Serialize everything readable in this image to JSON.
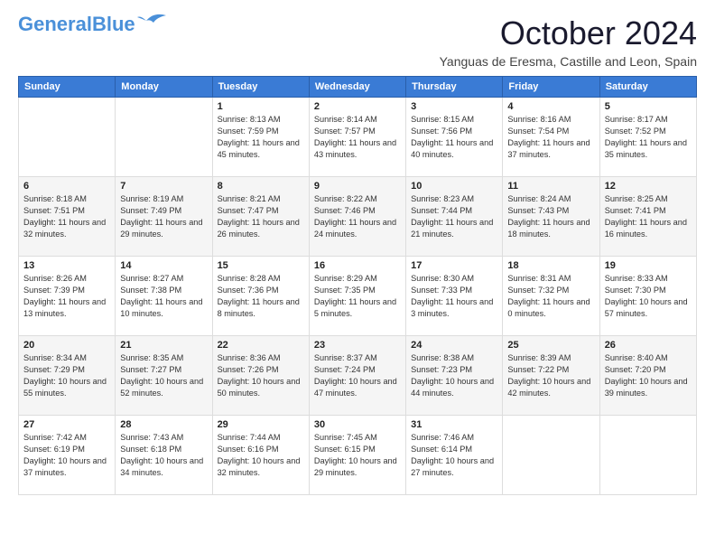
{
  "logo": {
    "line1": "General",
    "line2": "Blue"
  },
  "title": "October 2024",
  "location": "Yanguas de Eresma, Castille and Leon, Spain",
  "days_of_week": [
    "Sunday",
    "Monday",
    "Tuesday",
    "Wednesday",
    "Thursday",
    "Friday",
    "Saturday"
  ],
  "weeks": [
    [
      {
        "day": "",
        "info": ""
      },
      {
        "day": "",
        "info": ""
      },
      {
        "day": "1",
        "info": "Sunrise: 8:13 AM\nSunset: 7:59 PM\nDaylight: 11 hours and 45 minutes."
      },
      {
        "day": "2",
        "info": "Sunrise: 8:14 AM\nSunset: 7:57 PM\nDaylight: 11 hours and 43 minutes."
      },
      {
        "day": "3",
        "info": "Sunrise: 8:15 AM\nSunset: 7:56 PM\nDaylight: 11 hours and 40 minutes."
      },
      {
        "day": "4",
        "info": "Sunrise: 8:16 AM\nSunset: 7:54 PM\nDaylight: 11 hours and 37 minutes."
      },
      {
        "day": "5",
        "info": "Sunrise: 8:17 AM\nSunset: 7:52 PM\nDaylight: 11 hours and 35 minutes."
      }
    ],
    [
      {
        "day": "6",
        "info": "Sunrise: 8:18 AM\nSunset: 7:51 PM\nDaylight: 11 hours and 32 minutes."
      },
      {
        "day": "7",
        "info": "Sunrise: 8:19 AM\nSunset: 7:49 PM\nDaylight: 11 hours and 29 minutes."
      },
      {
        "day": "8",
        "info": "Sunrise: 8:21 AM\nSunset: 7:47 PM\nDaylight: 11 hours and 26 minutes."
      },
      {
        "day": "9",
        "info": "Sunrise: 8:22 AM\nSunset: 7:46 PM\nDaylight: 11 hours and 24 minutes."
      },
      {
        "day": "10",
        "info": "Sunrise: 8:23 AM\nSunset: 7:44 PM\nDaylight: 11 hours and 21 minutes."
      },
      {
        "day": "11",
        "info": "Sunrise: 8:24 AM\nSunset: 7:43 PM\nDaylight: 11 hours and 18 minutes."
      },
      {
        "day": "12",
        "info": "Sunrise: 8:25 AM\nSunset: 7:41 PM\nDaylight: 11 hours and 16 minutes."
      }
    ],
    [
      {
        "day": "13",
        "info": "Sunrise: 8:26 AM\nSunset: 7:39 PM\nDaylight: 11 hours and 13 minutes."
      },
      {
        "day": "14",
        "info": "Sunrise: 8:27 AM\nSunset: 7:38 PM\nDaylight: 11 hours and 10 minutes."
      },
      {
        "day": "15",
        "info": "Sunrise: 8:28 AM\nSunset: 7:36 PM\nDaylight: 11 hours and 8 minutes."
      },
      {
        "day": "16",
        "info": "Sunrise: 8:29 AM\nSunset: 7:35 PM\nDaylight: 11 hours and 5 minutes."
      },
      {
        "day": "17",
        "info": "Sunrise: 8:30 AM\nSunset: 7:33 PM\nDaylight: 11 hours and 3 minutes."
      },
      {
        "day": "18",
        "info": "Sunrise: 8:31 AM\nSunset: 7:32 PM\nDaylight: 11 hours and 0 minutes."
      },
      {
        "day": "19",
        "info": "Sunrise: 8:33 AM\nSunset: 7:30 PM\nDaylight: 10 hours and 57 minutes."
      }
    ],
    [
      {
        "day": "20",
        "info": "Sunrise: 8:34 AM\nSunset: 7:29 PM\nDaylight: 10 hours and 55 minutes."
      },
      {
        "day": "21",
        "info": "Sunrise: 8:35 AM\nSunset: 7:27 PM\nDaylight: 10 hours and 52 minutes."
      },
      {
        "day": "22",
        "info": "Sunrise: 8:36 AM\nSunset: 7:26 PM\nDaylight: 10 hours and 50 minutes."
      },
      {
        "day": "23",
        "info": "Sunrise: 8:37 AM\nSunset: 7:24 PM\nDaylight: 10 hours and 47 minutes."
      },
      {
        "day": "24",
        "info": "Sunrise: 8:38 AM\nSunset: 7:23 PM\nDaylight: 10 hours and 44 minutes."
      },
      {
        "day": "25",
        "info": "Sunrise: 8:39 AM\nSunset: 7:22 PM\nDaylight: 10 hours and 42 minutes."
      },
      {
        "day": "26",
        "info": "Sunrise: 8:40 AM\nSunset: 7:20 PM\nDaylight: 10 hours and 39 minutes."
      }
    ],
    [
      {
        "day": "27",
        "info": "Sunrise: 7:42 AM\nSunset: 6:19 PM\nDaylight: 10 hours and 37 minutes."
      },
      {
        "day": "28",
        "info": "Sunrise: 7:43 AM\nSunset: 6:18 PM\nDaylight: 10 hours and 34 minutes."
      },
      {
        "day": "29",
        "info": "Sunrise: 7:44 AM\nSunset: 6:16 PM\nDaylight: 10 hours and 32 minutes."
      },
      {
        "day": "30",
        "info": "Sunrise: 7:45 AM\nSunset: 6:15 PM\nDaylight: 10 hours and 29 minutes."
      },
      {
        "day": "31",
        "info": "Sunrise: 7:46 AM\nSunset: 6:14 PM\nDaylight: 10 hours and 27 minutes."
      },
      {
        "day": "",
        "info": ""
      },
      {
        "day": "",
        "info": ""
      }
    ]
  ]
}
